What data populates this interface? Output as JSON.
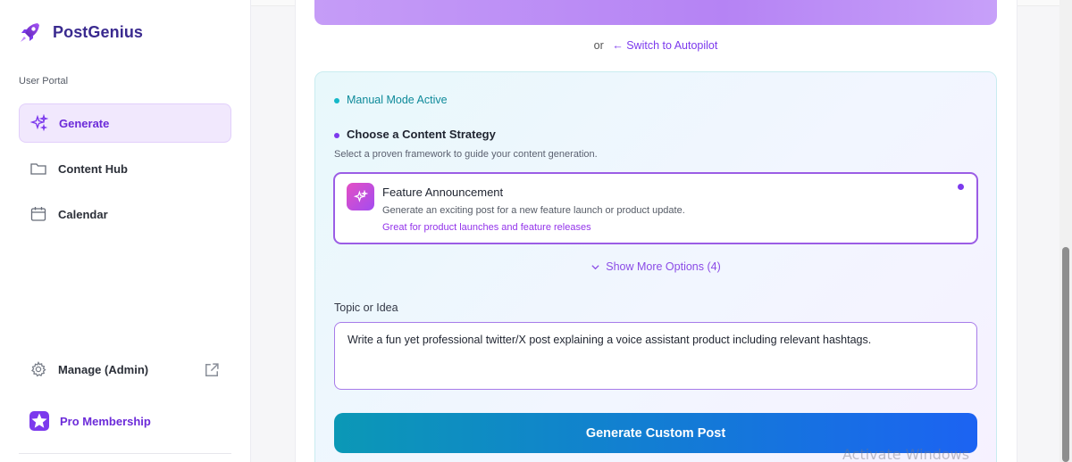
{
  "app": {
    "brand_name": "PostGenius",
    "brand_color": "#3a2a8f",
    "accent_color": "#7c3aed"
  },
  "sidebar": {
    "section_label": "User Portal",
    "items": [
      {
        "label": "Generate",
        "icon": "sparkles-icon",
        "active": true
      },
      {
        "label": "Content Hub",
        "icon": "folder-icon",
        "active": false
      },
      {
        "label": "Calendar",
        "icon": "calendar-icon",
        "active": false
      }
    ],
    "manage": {
      "label": "Manage (Admin)",
      "icon": "gear-icon",
      "trailing_icon": "external-link-icon"
    },
    "pro": {
      "label": "Pro Membership",
      "icon": "star-icon"
    }
  },
  "main": {
    "autopilot": {
      "or_text": "or",
      "link_text": "← Switch to Autopilot"
    },
    "manual_mode_label": "Manual Mode Active",
    "strategy": {
      "title": "Choose a Content Strategy",
      "subtitle": "Select a proven framework to guide your content generation.",
      "selected_option": {
        "title": "Feature Announcement",
        "description": "Generate an exciting post for a new feature launch or product update.",
        "tag": "Great for product launches and feature releases",
        "icon": "sparkles-icon"
      },
      "show_more_label": "Show More Options (4)"
    },
    "topic": {
      "label": "Topic or Idea",
      "value": "Write a fun yet professional twitter/X post explaining a voice assistant product including relevant hashtags."
    },
    "generate_button_label": "Generate Custom Post"
  },
  "os": {
    "watermark": "Activate Windows"
  }
}
